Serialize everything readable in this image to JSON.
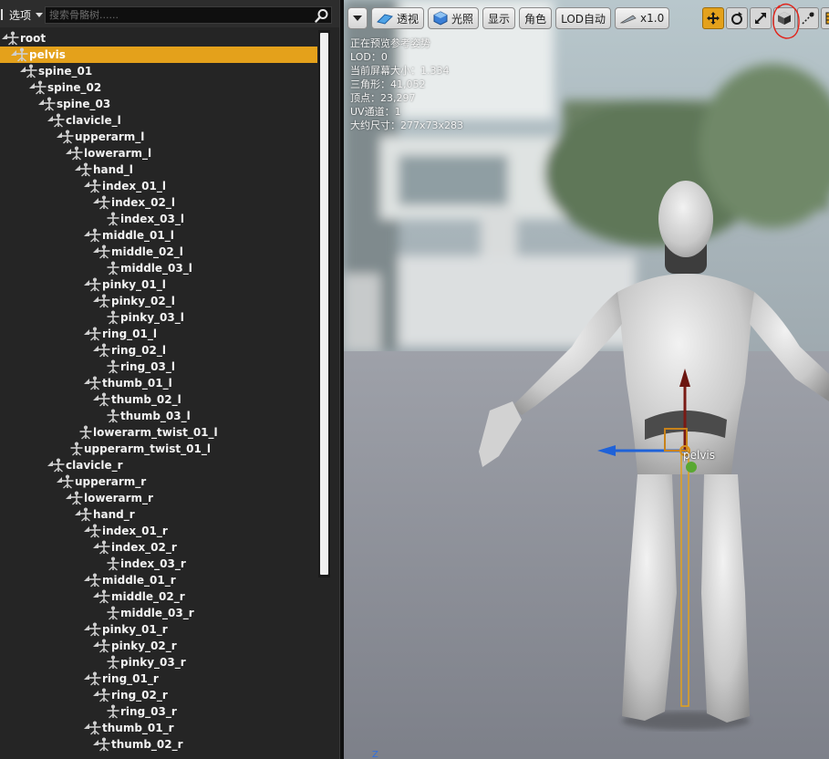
{
  "left_panel": {
    "options_label": "选项",
    "search_placeholder": "搜索骨骼树......",
    "bones": [
      {
        "name": "root",
        "depth": 0,
        "expanded": true,
        "selected": false
      },
      {
        "name": "pelvis",
        "depth": 1,
        "expanded": true,
        "selected": true
      },
      {
        "name": "spine_01",
        "depth": 2,
        "expanded": true,
        "selected": false
      },
      {
        "name": "spine_02",
        "depth": 3,
        "expanded": true,
        "selected": false
      },
      {
        "name": "spine_03",
        "depth": 4,
        "expanded": true,
        "selected": false
      },
      {
        "name": "clavicle_l",
        "depth": 5,
        "expanded": true,
        "selected": false
      },
      {
        "name": "upperarm_l",
        "depth": 6,
        "expanded": true,
        "selected": false
      },
      {
        "name": "lowerarm_l",
        "depth": 7,
        "expanded": true,
        "selected": false
      },
      {
        "name": "hand_l",
        "depth": 8,
        "expanded": true,
        "selected": false
      },
      {
        "name": "index_01_l",
        "depth": 9,
        "expanded": true,
        "selected": false
      },
      {
        "name": "index_02_l",
        "depth": 10,
        "expanded": true,
        "selected": false
      },
      {
        "name": "index_03_l",
        "depth": 11,
        "expanded": false,
        "selected": false
      },
      {
        "name": "middle_01_l",
        "depth": 9,
        "expanded": true,
        "selected": false
      },
      {
        "name": "middle_02_l",
        "depth": 10,
        "expanded": true,
        "selected": false
      },
      {
        "name": "middle_03_l",
        "depth": 11,
        "expanded": false,
        "selected": false
      },
      {
        "name": "pinky_01_l",
        "depth": 9,
        "expanded": true,
        "selected": false
      },
      {
        "name": "pinky_02_l",
        "depth": 10,
        "expanded": true,
        "selected": false
      },
      {
        "name": "pinky_03_l",
        "depth": 11,
        "expanded": false,
        "selected": false
      },
      {
        "name": "ring_01_l",
        "depth": 9,
        "expanded": true,
        "selected": false
      },
      {
        "name": "ring_02_l",
        "depth": 10,
        "expanded": true,
        "selected": false
      },
      {
        "name": "ring_03_l",
        "depth": 11,
        "expanded": false,
        "selected": false
      },
      {
        "name": "thumb_01_l",
        "depth": 9,
        "expanded": true,
        "selected": false
      },
      {
        "name": "thumb_02_l",
        "depth": 10,
        "expanded": true,
        "selected": false
      },
      {
        "name": "thumb_03_l",
        "depth": 11,
        "expanded": false,
        "selected": false
      },
      {
        "name": "lowerarm_twist_01_l",
        "depth": 8,
        "expanded": false,
        "selected": false
      },
      {
        "name": "upperarm_twist_01_l",
        "depth": 7,
        "expanded": false,
        "selected": false
      },
      {
        "name": "clavicle_r",
        "depth": 5,
        "expanded": true,
        "selected": false
      },
      {
        "name": "upperarm_r",
        "depth": 6,
        "expanded": true,
        "selected": false
      },
      {
        "name": "lowerarm_r",
        "depth": 7,
        "expanded": true,
        "selected": false
      },
      {
        "name": "hand_r",
        "depth": 8,
        "expanded": true,
        "selected": false
      },
      {
        "name": "index_01_r",
        "depth": 9,
        "expanded": true,
        "selected": false
      },
      {
        "name": "index_02_r",
        "depth": 10,
        "expanded": true,
        "selected": false
      },
      {
        "name": "index_03_r",
        "depth": 11,
        "expanded": false,
        "selected": false
      },
      {
        "name": "middle_01_r",
        "depth": 9,
        "expanded": true,
        "selected": false
      },
      {
        "name": "middle_02_r",
        "depth": 10,
        "expanded": true,
        "selected": false
      },
      {
        "name": "middle_03_r",
        "depth": 11,
        "expanded": false,
        "selected": false
      },
      {
        "name": "pinky_01_r",
        "depth": 9,
        "expanded": true,
        "selected": false
      },
      {
        "name": "pinky_02_r",
        "depth": 10,
        "expanded": true,
        "selected": false
      },
      {
        "name": "pinky_03_r",
        "depth": 11,
        "expanded": false,
        "selected": false
      },
      {
        "name": "ring_01_r",
        "depth": 9,
        "expanded": true,
        "selected": false
      },
      {
        "name": "ring_02_r",
        "depth": 10,
        "expanded": true,
        "selected": false
      },
      {
        "name": "ring_03_r",
        "depth": 11,
        "expanded": false,
        "selected": false
      },
      {
        "name": "thumb_01_r",
        "depth": 9,
        "expanded": true,
        "selected": false
      },
      {
        "name": "thumb_02_r",
        "depth": 10,
        "expanded": true,
        "selected": false
      }
    ]
  },
  "viewport": {
    "toolbar": {
      "perspective_label": "透视",
      "lit_label": "光照",
      "show_label": "显示",
      "character_label": "角色",
      "lod_label": "LOD自动",
      "speed_label": "x1.0"
    },
    "info_lines": [
      "正在预览参考姿势",
      "LOD：0",
      "当前屏幕大小：1.334",
      "三角形：41,052",
      "顶点：23,297",
      "UV通道：1",
      "大约尺寸：277x73x283"
    ],
    "selected_bone_label": "pelvis",
    "axis_label": "Z"
  },
  "colors": {
    "selection": "#e4a11b",
    "panel_bg": "#252525",
    "toolbar_bg": "#2d2d2d"
  }
}
